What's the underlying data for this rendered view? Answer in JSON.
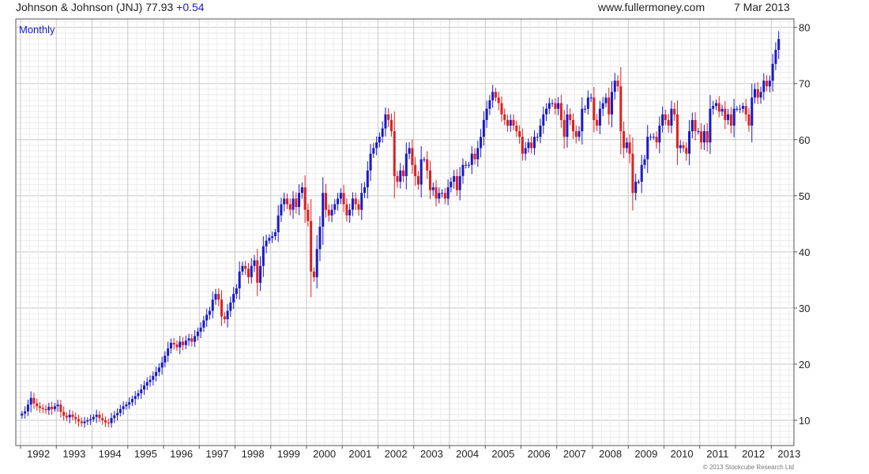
{
  "header": {
    "title": "Johnson & Johnson (JNJ)",
    "price": "77.93",
    "change": "+0.54",
    "site": "www.fullermoney.com",
    "date": "7 Mar 2013"
  },
  "period_label": "Monthly",
  "copyright": "© 2013 Stockcube Research Ltd",
  "colors": {
    "up": "#1a1ac8",
    "down": "#e02020",
    "grid": "#d6d6d6",
    "axis": "#555555"
  },
  "chart_data": {
    "type": "candlestick",
    "title": "Johnson & Johnson (JNJ)",
    "period": "Monthly",
    "x_tick_labels": [
      "1992",
      "1993",
      "1994",
      "1995",
      "1996",
      "1997",
      "1998",
      "1999",
      "2000",
      "2001",
      "2002",
      "2003",
      "2004",
      "2005",
      "2006",
      "2007",
      "2008",
      "2009",
      "2010",
      "2011",
      "2012",
      "2013"
    ],
    "y_ticks": [
      10,
      20,
      30,
      40,
      50,
      60,
      70,
      80
    ],
    "ylim": [
      5.5,
      81.5
    ],
    "grid": true,
    "monthly_close": [
      {
        "year": 1992,
        "close": [
          11.2,
          11.6,
          12.8,
          14.0,
          13.0,
          12.5,
          12.2,
          12.0,
          11.8,
          12.4,
          12.0,
          12.5
        ]
      },
      {
        "year": 1993,
        "close": [
          12.8,
          11.5,
          10.8,
          10.5,
          11.0,
          10.6,
          10.2,
          9.8,
          9.5,
          9.8,
          10.0,
          10.2
        ]
      },
      {
        "year": 1994,
        "close": [
          10.6,
          11.0,
          10.4,
          10.0,
          9.6,
          9.5,
          10.4,
          10.9,
          11.3,
          12.0,
          12.5,
          12.8
        ]
      },
      {
        "year": 1995,
        "close": [
          13.2,
          13.8,
          14.3,
          14.8,
          15.5,
          16.2,
          16.8,
          17.2,
          17.9,
          18.6,
          19.4,
          20.3
        ]
      },
      {
        "year": 1996,
        "close": [
          21.5,
          22.8,
          23.8,
          23.5,
          23.0,
          24.0,
          23.4,
          24.2,
          24.6,
          24.0,
          25.0,
          25.8
        ]
      },
      {
        "year": 1997,
        "close": [
          26.5,
          27.8,
          28.8,
          29.5,
          31.5,
          32.5,
          31.5,
          28.5,
          28.0,
          29.5,
          31.0,
          32.5
        ]
      },
      {
        "year": 1998,
        "close": [
          33.5,
          36.5,
          37.5,
          37.0,
          35.5,
          37.5,
          38.5,
          34.5,
          37.5,
          41.0,
          42.0,
          42.5
        ]
      },
      {
        "year": 1999,
        "close": [
          42.8,
          43.5,
          46.5,
          48.5,
          49.5,
          48.5,
          47.5,
          49.5,
          48.0,
          50.5,
          51.5,
          47.5
        ]
      },
      {
        "year": 2000,
        "close": [
          45.5,
          36.5,
          35.5,
          40.5,
          44.5,
          50.5,
          47.5,
          46.5,
          47.5,
          48.5,
          49.5,
          50.5
        ]
      },
      {
        "year": 2001,
        "close": [
          48.5,
          46.5,
          47.5,
          49.5,
          48.5,
          47.5,
          50.5,
          51.5,
          54.5,
          57.5,
          58.5,
          59.5
        ]
      },
      {
        "year": 2002,
        "close": [
          60.5,
          62.0,
          64.5,
          63.5,
          61.5,
          53.5,
          52.5,
          54.5,
          53.5,
          57.5,
          58.5,
          55.5
        ]
      },
      {
        "year": 2003,
        "close": [
          53.5,
          52.0,
          56.5,
          56.5,
          54.5,
          51.0,
          51.5,
          49.5,
          50.5,
          50.5,
          49.5,
          51.5
        ]
      },
      {
        "year": 2004,
        "close": [
          52.5,
          53.5,
          51.0,
          53.5,
          55.5,
          55.5,
          55.5,
          57.5,
          56.5,
          58.5,
          60.5,
          63.5
        ]
      },
      {
        "year": 2005,
        "close": [
          65.5,
          67.0,
          68.5,
          67.5,
          66.5,
          64.5,
          63.5,
          62.5,
          63.5,
          62.5,
          61.5,
          60.5
        ]
      },
      {
        "year": 2006,
        "close": [
          57.5,
          58.5,
          59.5,
          58.5,
          60.5,
          60.5,
          62.5,
          64.5,
          65.5,
          66.5,
          66.5,
          65.5
        ]
      },
      {
        "year": 2007,
        "close": [
          66.5,
          63.5,
          60.5,
          64.5,
          63.5,
          61.5,
          60.5,
          61.5,
          65.5,
          65.5,
          67.5,
          67.5
        ]
      },
      {
        "year": 2008,
        "close": [
          63.5,
          62.5,
          65.5,
          66.5,
          67.5,
          64.5,
          68.5,
          70.5,
          69.5,
          61.5,
          58.5,
          59.5
        ]
      },
      {
        "year": 2009,
        "close": [
          57.5,
          50.5,
          52.5,
          52.5,
          55.5,
          56.5,
          60.5,
          60.5,
          60.5,
          59.5,
          62.5,
          64.5
        ]
      },
      {
        "year": 2010,
        "close": [
          63.5,
          62.5,
          65.5,
          64.5,
          58.5,
          59.0,
          58.5,
          57.5,
          61.5,
          63.5,
          61.5,
          61.5
        ]
      },
      {
        "year": 2011,
        "close": [
          59.5,
          61.5,
          59.5,
          65.5,
          66.0,
          66.5,
          65.0,
          65.5,
          63.5,
          64.5,
          62.5,
          65.5
        ]
      },
      {
        "year": 2012,
        "close": [
          65.5,
          65.5,
          66.0,
          64.5,
          62.5,
          67.5,
          69.0,
          67.5,
          68.5,
          70.5,
          69.5,
          70.5
        ]
      },
      {
        "year": 2013,
        "close": [
          73.5,
          76.0,
          77.93
        ]
      }
    ]
  }
}
